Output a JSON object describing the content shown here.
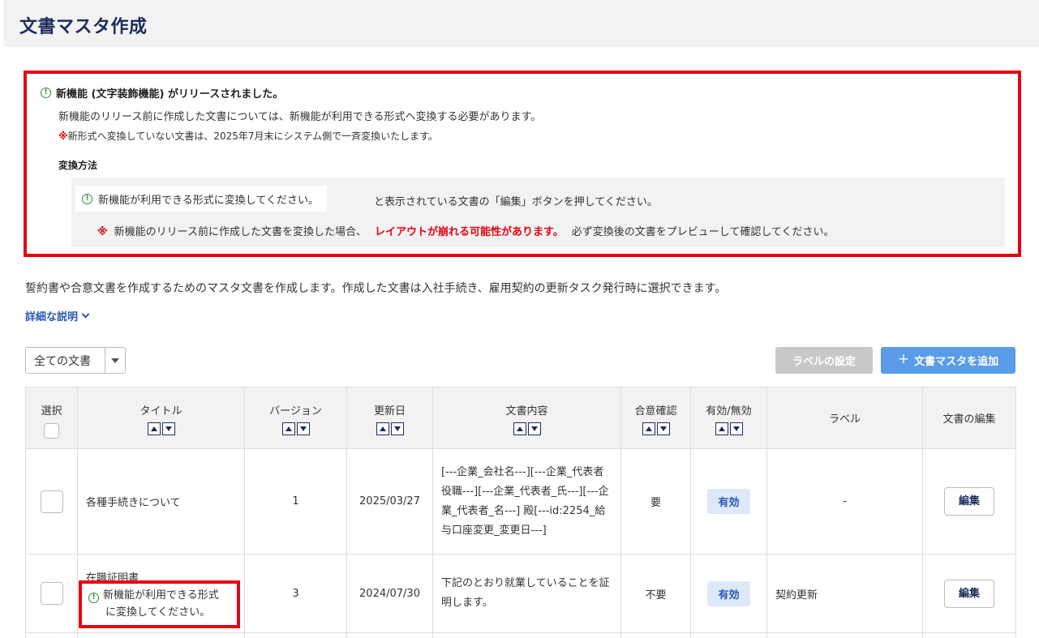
{
  "page": {
    "title": "文書マスタ作成"
  },
  "notice": {
    "headline": "新機能 (文字装飾機能) がリリースされました。",
    "line1": "新機能のリリース前に作成した文書については、新機能が利用できる形式へ変換する必要があります。",
    "line2_mark": "※",
    "line2": "新形式へ変換していない文書は、2025年7月末にシステム側で一斉変換いたします。",
    "method_title": "変換方法",
    "method_pill": "新機能が利用できる形式に変換してください。",
    "method_after": "と表示されている文書の「編集」ボタンを押してください。",
    "warn_mark": "※",
    "warn_before": "新機能のリリース前に作成した文書を変換した場合、",
    "warn_red": "レイアウトが崩れる可能性があります。",
    "warn_after": "必ず変換後の文書をプレビューして確認してください。"
  },
  "description": "誓約書や合意文書を作成するためのマスタ文書を作成します。作成した文書は入社手続き、雇用契約の更新タスク発行時に選択できます。",
  "details_link": "詳細な説明",
  "toolbar": {
    "filter_value": "全ての文書",
    "label_button": "ラベルの設定",
    "add_button": "文書マスタを追加",
    "add_icon": "+"
  },
  "table": {
    "headers": {
      "select": "選択",
      "title": "タイトル",
      "version": "バージョン",
      "updated": "更新日",
      "content": "文書内容",
      "consent": "合意確認",
      "status": "有効/無効",
      "label": "ラベル",
      "edit": "文書の編集"
    },
    "rows": [
      {
        "title": "各種手続きについて",
        "version": "1",
        "updated": "2025/03/27",
        "content": "[---企業_会社名---][---企業_代表者役職---][---企業_代表者_氏---][---企業_代表者_名---] 殿[---id:2254_給与口座変更_変更日---]",
        "consent": "要",
        "status": "有効",
        "label": "-",
        "edit": "編集"
      },
      {
        "title": "在職証明書",
        "convert_notice_1": "新機能が利用できる形式",
        "convert_notice_2": "に変換してください。",
        "version": "3",
        "updated": "2024/07/30",
        "content": "下記のとおり就業していることを証明します。",
        "consent": "不要",
        "status": "有効",
        "label": "契約更新",
        "edit": "編集"
      }
    ]
  },
  "icons": {
    "info": "info-circle-icon",
    "sort_up": "sort-up-icon",
    "sort_down": "sort-down-icon",
    "chevron": "chevron-down-icon"
  },
  "colors": {
    "alert_red": "#e60012",
    "primary_blue": "#5a9bea",
    "link_blue": "#2a58b5",
    "title_navy": "#1d2c5c",
    "info_green": "#2e8b3d"
  }
}
